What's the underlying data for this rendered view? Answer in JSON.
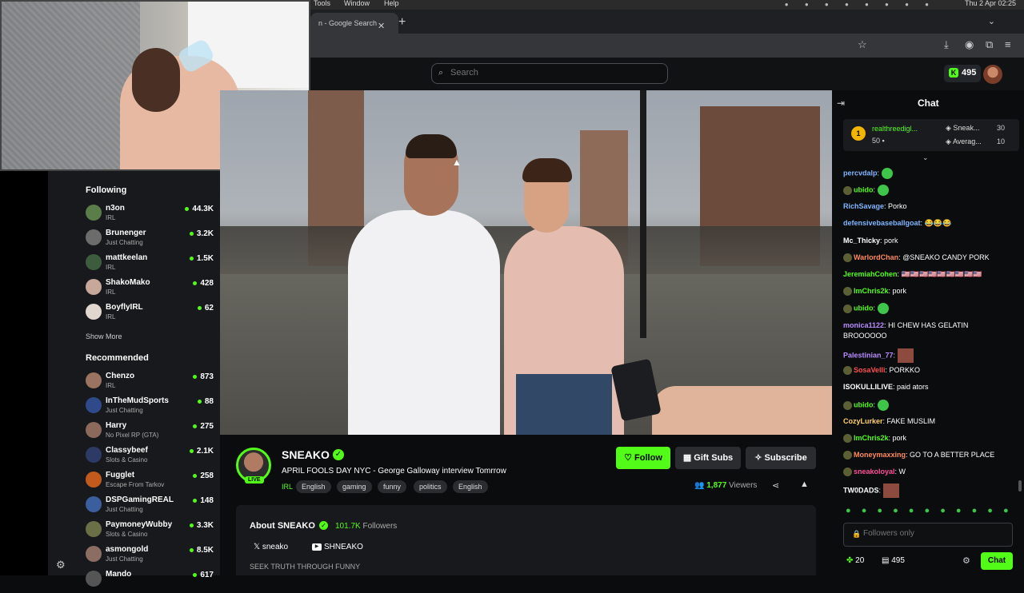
{
  "menubar": {
    "tools": "Tools",
    "window": "Window",
    "help": "Help",
    "datetime": "Thu 2 Apr  02:25"
  },
  "browser": {
    "tab_title": "n - Google Search",
    "new_tab": "+",
    "close": "✕"
  },
  "header": {
    "search_placeholder": "Search",
    "points": "495"
  },
  "sidebar": {
    "following_title": "Following",
    "following": [
      {
        "name": "n3on",
        "category": "IRL",
        "viewers": "44.3K",
        "color": "#5a7d4a"
      },
      {
        "name": "Brunenger",
        "category": "Just Chatting",
        "viewers": "3.2K",
        "color": "#6c6c6c"
      },
      {
        "name": "mattkeelan",
        "category": "IRL",
        "viewers": "1.5K",
        "color": "#3d5c3d"
      },
      {
        "name": "ShakoMako",
        "category": "IRL",
        "viewers": "428",
        "color": "#c7a89a"
      },
      {
        "name": "BoyflyIRL",
        "category": "IRL",
        "viewers": "62",
        "color": "#e2d7cf"
      }
    ],
    "show_more": "Show More",
    "recommended_title": "Recommended",
    "recommended": [
      {
        "name": "Chenzo",
        "category": "IRL",
        "viewers": "873",
        "color": "#9a7460"
      },
      {
        "name": "InTheMudSports",
        "category": "Just Chatting",
        "viewers": "88",
        "color": "#2f4a8a"
      },
      {
        "name": "Harry",
        "category": "No Pixel RP (GTA)",
        "viewers": "275",
        "color": "#8b6a5c"
      },
      {
        "name": "Classybeef",
        "category": "Slots & Casino",
        "viewers": "2.1K",
        "color": "#2e3a66"
      },
      {
        "name": "Fugglet",
        "category": "Escape From Tarkov",
        "viewers": "258",
        "color": "#c35a1d"
      },
      {
        "name": "DSPGamingREAL",
        "category": "Just Chatting",
        "viewers": "148",
        "color": "#3b5f9e"
      },
      {
        "name": "PaymoneyWubby",
        "category": "Slots & Casino",
        "viewers": "3.3K",
        "color": "#6b6f48"
      },
      {
        "name": "asmongold",
        "category": "Just Chatting",
        "viewers": "8.5K",
        "color": "#8c6d63"
      },
      {
        "name": "Mando",
        "category": "",
        "viewers": "617",
        "color": "#555"
      }
    ]
  },
  "channel": {
    "name": "SNEAKO",
    "live": "LIVE",
    "title": "APRIL FOOLS DAY NYC - George Galloway interview Tomrrow",
    "category": "IRL",
    "tags": [
      "English",
      "gaming",
      "funny",
      "politics",
      "English"
    ],
    "follow": "Follow",
    "gift": "Gift Subs",
    "subscribe": "Subscribe",
    "viewers": "1,877",
    "viewers_label": "Viewers",
    "about_title": "About SNEAKO",
    "followers": "101.7K",
    "followers_label": "Followers",
    "social_x": "sneako",
    "social_yt": "SHNEAKO",
    "bio": "SEEK TRUTH THROUGH FUNNY"
  },
  "chat": {
    "title": "Chat",
    "pinned": {
      "user": "realthreedigl...",
      "amount": "50",
      "s1_name": "Sneak...",
      "s1_val": "30",
      "s2_name": "Averag...",
      "s2_val": "10"
    },
    "messages": [
      {
        "user": "percvdalp",
        "color": "#7fb6ff",
        "text": "",
        "badge": false,
        "emote": true
      },
      {
        "user": "ubido",
        "color": "#53fc18",
        "text": "",
        "badge": true,
        "emote": true
      },
      {
        "user": "RichSavage",
        "color": "#7fb6ff",
        "text": "Porko",
        "badge": false,
        "emote": false
      },
      {
        "user": "defensivebaseballgoat",
        "color": "#7fb6ff",
        "text": "😂😂😂",
        "badge": false,
        "emote": false
      },
      {
        "user": "Mc_Thicky",
        "color": "#ffffff",
        "text": "pork",
        "badge": false,
        "emote": false
      },
      {
        "user": "WarlordChan",
        "color": "#ff8a5c",
        "text": "@SNEAKO CANDY PORK",
        "badge": true,
        "emote": false
      },
      {
        "user": "JeremiahCohen",
        "color": "#53fc18",
        "text": "🇺🇸🇺🇸🇺🇸🇺🇸🇺🇸🇺🇸🇺🇸🇺🇸🇺🇸",
        "badge": false,
        "emote": false
      },
      {
        "user": "ImChris2k",
        "color": "#53fc18",
        "text": "pork",
        "badge": true,
        "emote": false
      },
      {
        "user": "ubido",
        "color": "#53fc18",
        "text": "",
        "badge": true,
        "emote": true
      },
      {
        "user": "monica1122",
        "color": "#b98cff",
        "text": "HI CHEW HAS GELATIN BROOOOOO",
        "badge": false,
        "emote": false
      },
      {
        "user": "Palestinian_77",
        "color": "#b98cff",
        "text": "",
        "badge": false,
        "emote": false,
        "img": true
      },
      {
        "user": "SosaVelli",
        "color": "#ff4f4f",
        "text": "PORKKO",
        "badge": true,
        "emote": false
      },
      {
        "user": "ISOKULLILIVE",
        "color": "#ffffff",
        "text": "paid ators",
        "badge": false,
        "emote": false
      },
      {
        "user": "ubido",
        "color": "#53fc18",
        "text": "",
        "badge": true,
        "emote": true
      },
      {
        "user": "CozyLurker",
        "color": "#ffd166",
        "text": "FAKE MUSLIM",
        "badge": false,
        "emote": false
      },
      {
        "user": "ImChris2k",
        "color": "#53fc18",
        "text": "pork",
        "badge": true,
        "emote": false
      },
      {
        "user": "Moneymaxxing",
        "color": "#ff8a5c",
        "text": "GO TO A BETTER PLACE",
        "badge": true,
        "emote": false
      },
      {
        "user": "sneakoloyal",
        "color": "#ff4f9a",
        "text": "W",
        "badge": true,
        "emote": false
      },
      {
        "user": "TW0DADS",
        "color": "#ffffff",
        "text": "",
        "badge": false,
        "emote": false,
        "img": true
      }
    ],
    "input_placeholder": "Followers only",
    "footer_points": "20",
    "footer_box": "495",
    "send": "Chat"
  }
}
